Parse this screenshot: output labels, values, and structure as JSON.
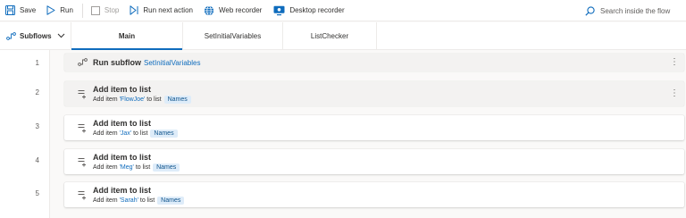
{
  "toolbar": {
    "save": "Save",
    "run": "Run",
    "stop": "Stop",
    "run_next": "Run next action",
    "web_recorder": "Web recorder",
    "desktop_recorder": "Desktop recorder",
    "search_placeholder": "Search inside the flow"
  },
  "tabs": {
    "subflows": "Subflows",
    "items": [
      "Main",
      "SetInitialVariables",
      "ListChecker"
    ],
    "active": "Main"
  },
  "actions": [
    {
      "line": "1",
      "title": "Run subflow",
      "subflow": "SetInitialVariables",
      "icon": "subflow-icon"
    },
    {
      "line": "2",
      "title": "Add item to list",
      "prefix": "Add item ",
      "item": "'FlowJoe'",
      "mid": " to list ",
      "list": "Names",
      "icon": "add-list-icon"
    },
    {
      "line": "3",
      "title": "Add item to list",
      "prefix": "Add item ",
      "item": "'Jax'",
      "mid": " to list ",
      "list": "Names",
      "icon": "add-list-icon"
    },
    {
      "line": "4",
      "title": "Add item to list",
      "prefix": "Add item ",
      "item": "'Meg'",
      "mid": " to list ",
      "list": "Names",
      "icon": "add-list-icon"
    },
    {
      "line": "5",
      "title": "Add item to list",
      "prefix": "Add item ",
      "item": "'Sarah'",
      "mid": " to list ",
      "list": "Names",
      "icon": "add-list-icon"
    }
  ],
  "colors": {
    "accent": "#0f6cbd",
    "variable_bg": "#deecf9"
  }
}
